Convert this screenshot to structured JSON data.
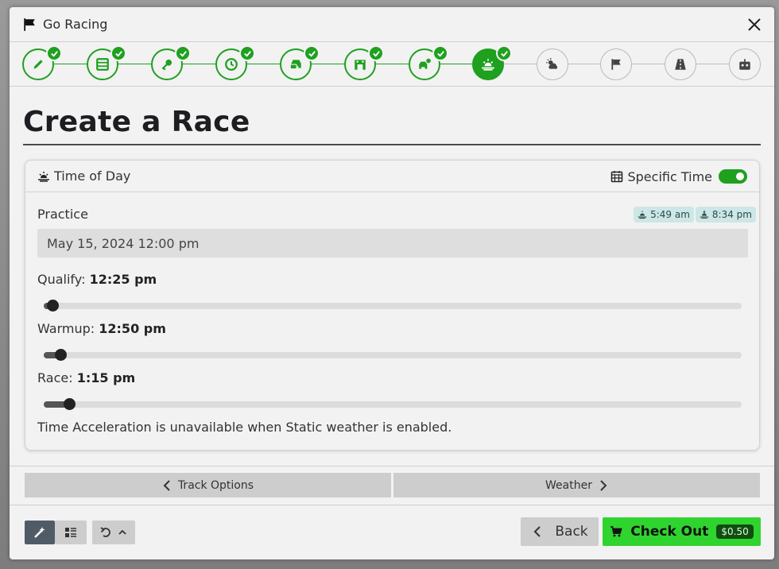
{
  "window": {
    "title": "Go Racing"
  },
  "colors": {
    "accent": "#1fa01f",
    "checkout": "#2fd42f",
    "price_bg": "#114d11"
  },
  "stepper": {
    "steps": [
      {
        "icon": "pencil-icon",
        "state": "done"
      },
      {
        "icon": "server-icon",
        "state": "done"
      },
      {
        "icon": "key-icon",
        "state": "done"
      },
      {
        "icon": "clock-icon",
        "state": "done"
      },
      {
        "icon": "cars-icon",
        "state": "done"
      },
      {
        "icon": "garage-icon",
        "state": "done"
      },
      {
        "icon": "car-settings-icon",
        "state": "done"
      },
      {
        "icon": "sunrise-icon",
        "state": "active"
      },
      {
        "icon": "weather-icon",
        "state": "todo"
      },
      {
        "icon": "flag-icon",
        "state": "todo"
      },
      {
        "icon": "road-icon",
        "state": "todo"
      },
      {
        "icon": "robot-icon",
        "state": "todo"
      }
    ]
  },
  "page": {
    "title": "Create a Race"
  },
  "time_of_day": {
    "header_label": "Time of Day",
    "specific_time_label": "Specific Time",
    "specific_time_on": true,
    "practice_label": "Practice",
    "sunrise": "5:49 am",
    "sunset": "8:34 pm",
    "practice_datetime": "May 15, 2024 12:00 pm",
    "sessions": [
      {
        "name": "Qualify:",
        "time": "12:25 pm",
        "level": 0.012
      },
      {
        "name": "Warmup:",
        "time": "12:50 pm",
        "level": 0.024
      },
      {
        "name": "Race:",
        "time": "1:15 pm",
        "level": 0.037
      }
    ],
    "note": "Time Acceleration is unavailable when Static weather is enabled."
  },
  "nav": {
    "prev_label": "Track Options",
    "next_label": "Weather"
  },
  "footer": {
    "back_label": "Back",
    "checkout_label": "Check Out",
    "price": "$0.50"
  }
}
